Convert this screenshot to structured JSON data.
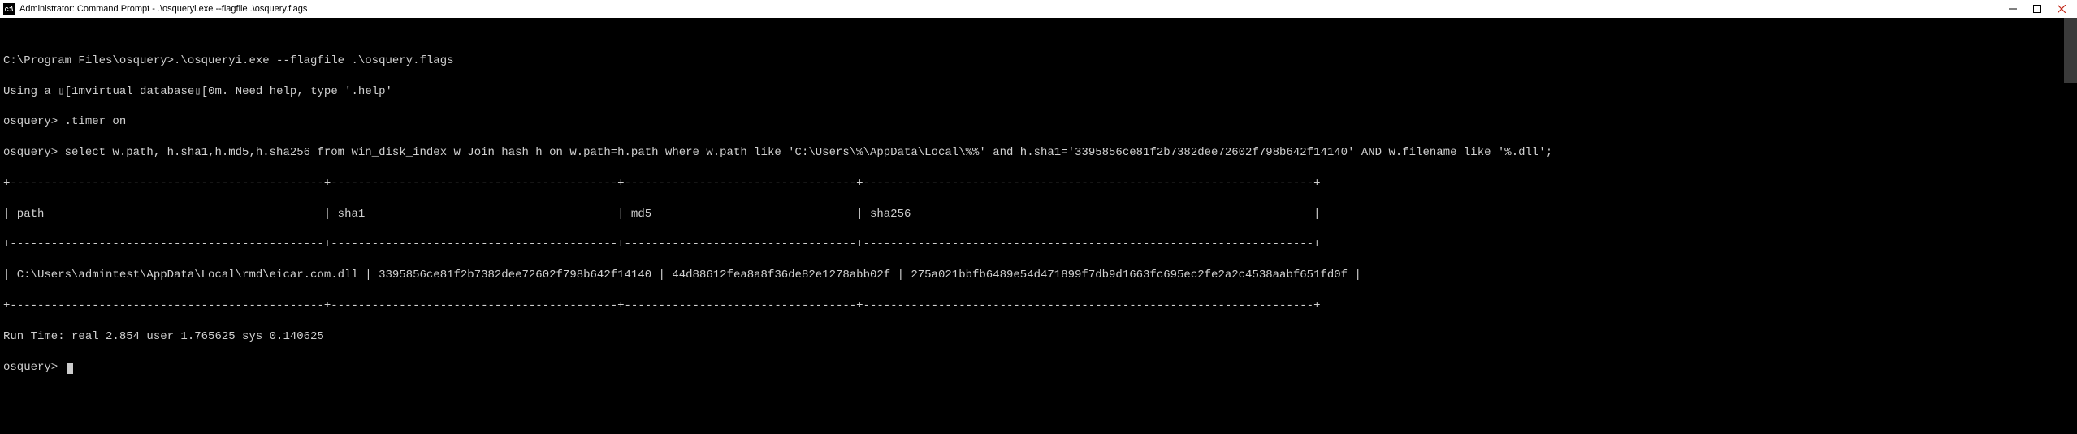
{
  "window": {
    "title": "Administrator: Command Prompt - .\\osqueryi.exe  --flagfile .\\osquery.flags"
  },
  "terminal": {
    "lines": [
      "",
      "C:\\Program Files\\osquery>.\\osqueryi.exe --flagfile .\\osquery.flags",
      "Using a ▯[1mvirtual database▯[0m. Need help, type '.help'",
      "osquery> .timer on",
      "osquery> select w.path, h.sha1,h.md5,h.sha256 from win_disk_index w Join hash h on w.path=h.path where w.path like 'C:\\Users\\%\\AppData\\Local\\%%' and h.sha1='3395856ce81f2b7382dee72602f798b642f14140' AND w.filename like '%.dll';",
      "+----------------------------------------------+------------------------------------------+----------------------------------+------------------------------------------------------------------+",
      "| path                                         | sha1                                     | md5                              | sha256                                                           |",
      "+----------------------------------------------+------------------------------------------+----------------------------------+------------------------------------------------------------------+",
      "| C:\\Users\\admintest\\AppData\\Local\\rmd\\eicar.com.dll | 3395856ce81f2b7382dee72602f798b642f14140 | 44d88612fea8a8f36de82e1278abb02f | 275a021bbfb6489e54d471899f7db9d1663fc695ec2fe2a2c4538aabf651fd0f |",
      "+----------------------------------------------+------------------------------------------+----------------------------------+------------------------------------------------------------------+",
      "Run Time: real 2.854 user 1.765625 sys 0.140625"
    ],
    "prompt": "osquery> "
  }
}
